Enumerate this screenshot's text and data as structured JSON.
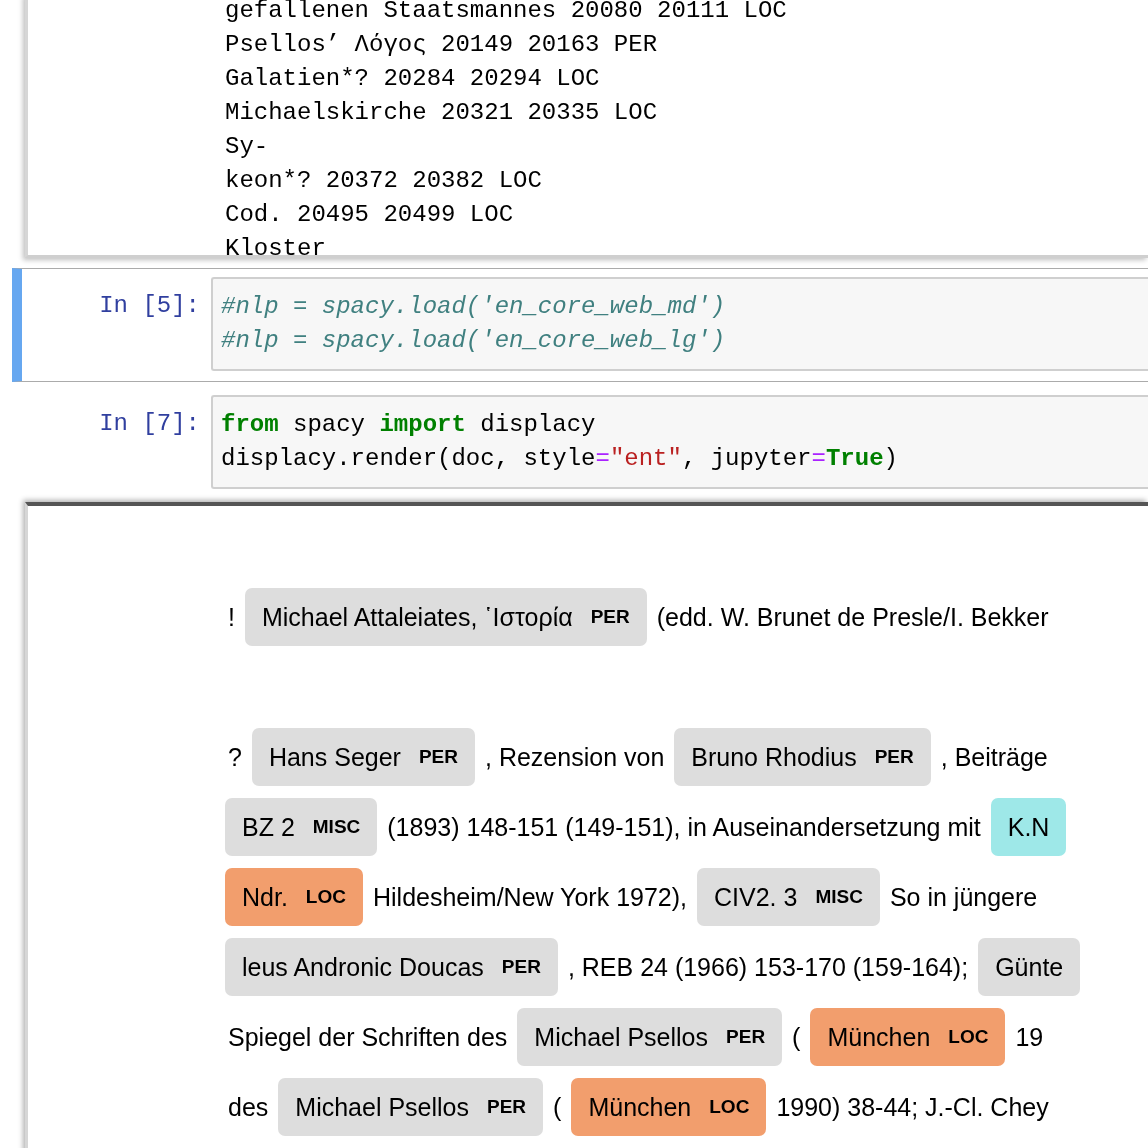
{
  "stream_output": {
    "lines": [
      "gefallenen Staatsmannes 20080 20111 LOC",
      "Psellos’ Λόγος 20149 20163 PER",
      "Galatien*? 20284 20294 LOC",
      "Michaelskirche 20321 20335 LOC",
      "Sy-",
      "keon*? 20372 20382 LOC",
      "Cod. 20495 20499 LOC",
      "Kloster"
    ]
  },
  "cells": [
    {
      "prompt": "In [5]:",
      "selected": true,
      "lines": [
        [
          {
            "kind": "comment",
            "text": "#nlp = spacy.load('en_core_web_md')"
          }
        ],
        [
          {
            "kind": "comment",
            "text": "#nlp = spacy.load('en_core_web_lg')"
          }
        ]
      ]
    },
    {
      "prompt": "In [7]:",
      "selected": false,
      "lines": [
        [
          {
            "kind": "keyword",
            "text": "from"
          },
          {
            "kind": "plain",
            "text": " spacy "
          },
          {
            "kind": "keyword",
            "text": "import"
          },
          {
            "kind": "plain",
            "text": " displacy"
          }
        ],
        [
          {
            "kind": "plain",
            "text": "displacy.render(doc, style"
          },
          {
            "kind": "operator",
            "text": "="
          },
          {
            "kind": "string",
            "text": "\"ent\""
          },
          {
            "kind": "plain",
            "text": ", jupyter"
          },
          {
            "kind": "operator",
            "text": "="
          },
          {
            "kind": "keyword",
            "text": "True"
          },
          {
            "kind": "plain",
            "text": ")"
          }
        ]
      ]
    }
  ],
  "displacy_output": {
    "paragraphs": [
      {
        "lines": [
          [
            {
              "kind": "text",
              "text": "!"
            },
            {
              "kind": "entity",
              "text": "Michael Attaleiates, ῾Ιστορία",
              "label": "PER",
              "color": "#dddddd"
            },
            {
              "kind": "text",
              "text": "(edd. W. Brunet de Presle/I. Bekker"
            }
          ]
        ]
      },
      {
        "lines": [
          [
            {
              "kind": "text",
              "text": "?"
            },
            {
              "kind": "entity",
              "text": "Hans Seger",
              "label": "PER",
              "color": "#dddddd"
            },
            {
              "kind": "text",
              "text": ", Rezension von"
            },
            {
              "kind": "entity",
              "text": "Bruno Rhodius",
              "label": "PER",
              "color": "#dddddd"
            },
            {
              "kind": "text",
              "text": ", Beiträge"
            }
          ],
          [
            {
              "kind": "entity",
              "text": "BZ 2",
              "label": "MISC",
              "color": "#dddddd"
            },
            {
              "kind": "text",
              "text": "(1893) 148-151 (149-151), in Auseinandersetzung mit"
            },
            {
              "kind": "entity",
              "text": "K.N",
              "color": "#9ee8e8"
            }
          ],
          [
            {
              "kind": "entity",
              "text": "Ndr.",
              "label": "LOC",
              "color": "#f29e6d"
            },
            {
              "kind": "text",
              "text": "Hildesheim/New York 1972),"
            },
            {
              "kind": "entity",
              "text": "CIV2. 3",
              "label": "MISC",
              "color": "#dddddd"
            },
            {
              "kind": "text",
              "text": "So in jüngere"
            }
          ],
          [
            {
              "kind": "entity",
              "text": "leus Andronic Doucas",
              "label": "PER",
              "color": "#dddddd"
            },
            {
              "kind": "text",
              "text": ", REB 24 (1966) 153-170 (159-164);"
            },
            {
              "kind": "entity",
              "text": "Günte",
              "color": "#dddddd"
            }
          ],
          [
            {
              "kind": "text",
              "text": "Spiegel der Schriften des"
            },
            {
              "kind": "entity",
              "text": "Michael Psellos",
              "label": "PER",
              "color": "#dddddd"
            },
            {
              "kind": "text",
              "text": "("
            },
            {
              "kind": "entity",
              "text": "München",
              "label": "LOC",
              "color": "#f29e6d"
            },
            {
              "kind": "text",
              "text": "19"
            }
          ],
          [
            {
              "kind": "text",
              "text": "des"
            },
            {
              "kind": "entity",
              "text": "Michael Psellos",
              "label": "PER",
              "color": "#dddddd"
            },
            {
              "kind": "text",
              "text": "("
            },
            {
              "kind": "entity",
              "text": "München",
              "label": "LOC",
              "color": "#f29e6d"
            },
            {
              "kind": "text",
              "text": "1990) 38-44; J.-Cl. Chey"
            }
          ]
        ]
      }
    ]
  }
}
